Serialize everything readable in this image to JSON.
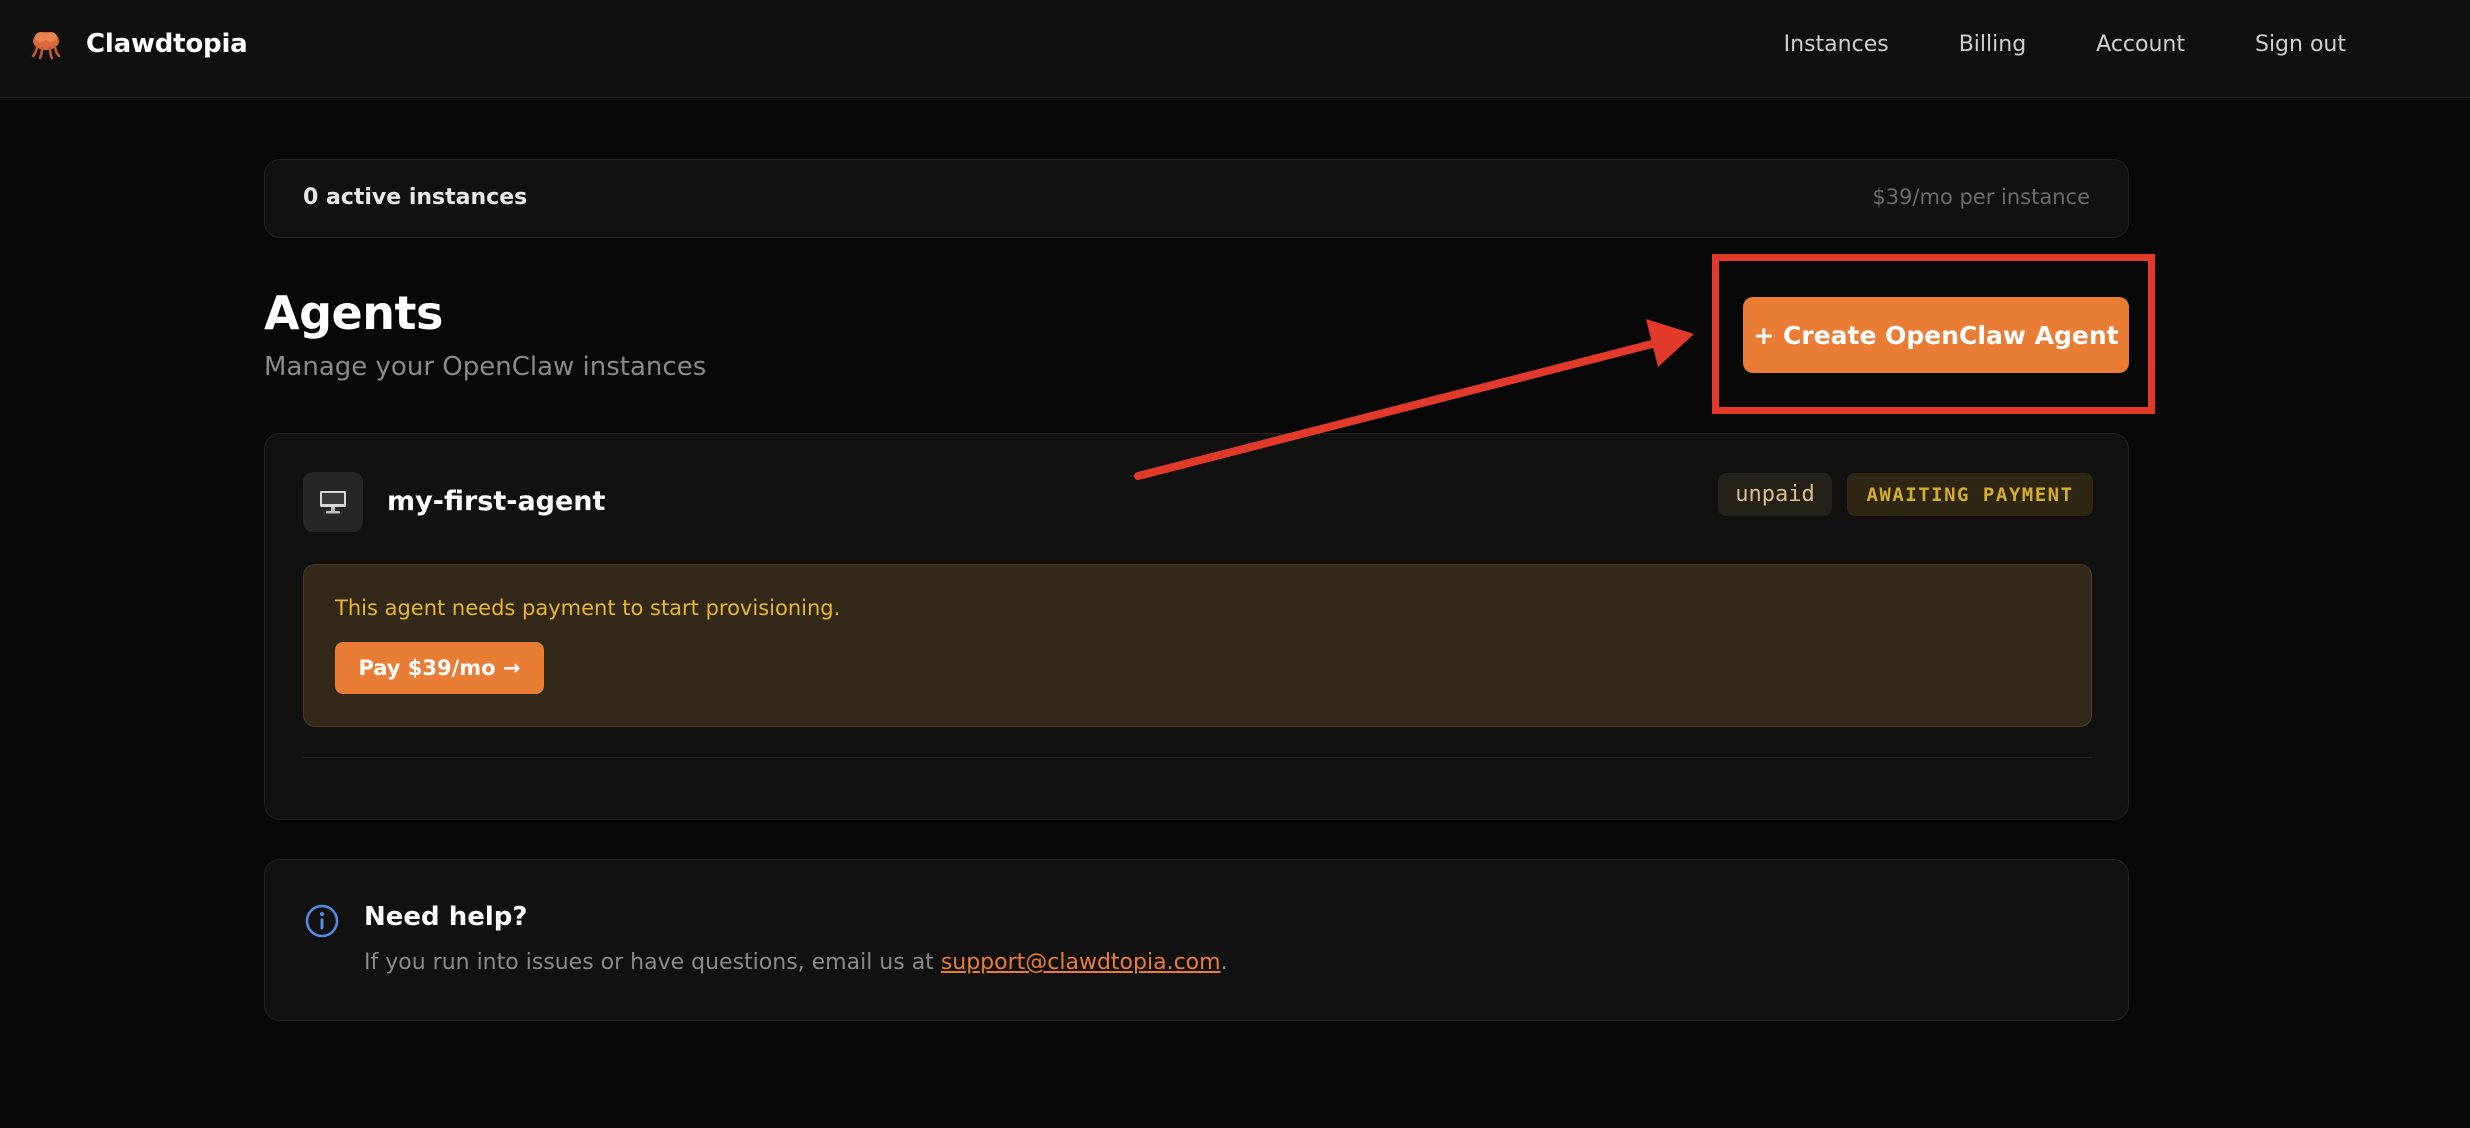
{
  "app": {
    "name": "Clawdtopia"
  },
  "nav": {
    "items": [
      {
        "label": "Instances"
      },
      {
        "label": "Billing"
      },
      {
        "label": "Account"
      },
      {
        "label": "Sign out"
      }
    ]
  },
  "stats": {
    "active_count": "0 active instances",
    "price_note": "$39/mo per instance"
  },
  "header": {
    "title": "Agents",
    "subtitle": "Manage your OpenClaw instances",
    "create_button_label": "+ Create OpenClaw Agent"
  },
  "agents": [
    {
      "name": "my-first-agent",
      "icon": "monitor-icon",
      "payment_status": "unpaid",
      "status": "AWAITING PAYMENT",
      "payment_message": "This agent needs payment to start provisioning.",
      "pay_button_label": "Pay $39/mo →"
    }
  ],
  "help": {
    "title": "Need help?",
    "text_before": "If you run into issues or have questions, email us at ",
    "email": "support@clawdtopia.com",
    "text_after": "."
  },
  "colors": {
    "accent": "#ea7d35",
    "annotation": "#e23a2a",
    "warning": "#e7b52f",
    "info": "#4f8fe8",
    "background": "#080808"
  }
}
